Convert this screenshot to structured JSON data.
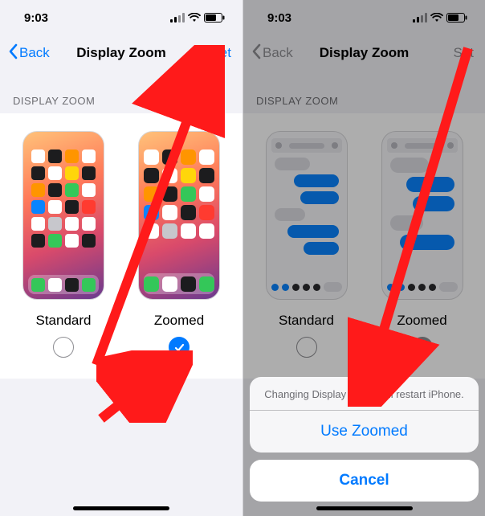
{
  "status": {
    "time": "9:03"
  },
  "nav": {
    "back": "Back",
    "title": "Display Zoom",
    "set": "Set"
  },
  "section_header": "DISPLAY ZOOM",
  "options": {
    "standard": "Standard",
    "zoomed": "Zoomed"
  },
  "sheet": {
    "message": "Changing Display Zoom will restart iPhone.",
    "action": "Use Zoomed",
    "cancel": "Cancel"
  }
}
